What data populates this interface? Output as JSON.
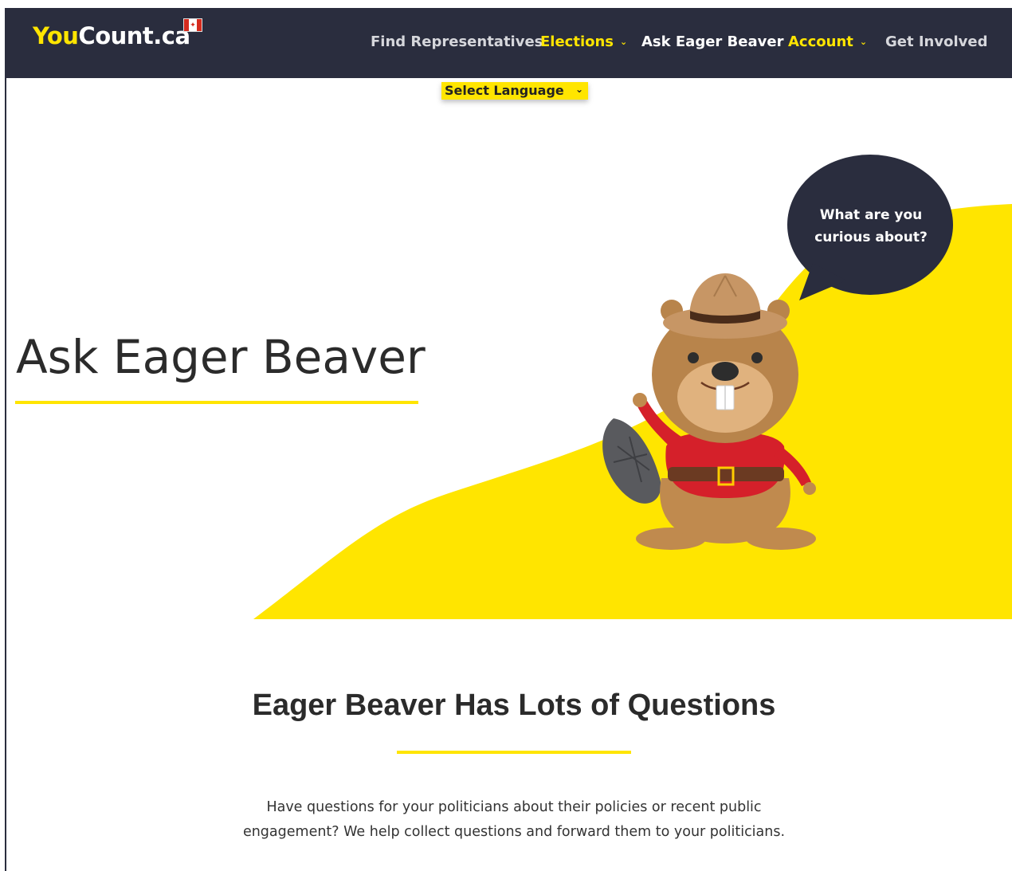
{
  "header": {
    "logo_you": "You",
    "logo_rest": "Count.ca",
    "flag_icon": "canada-flag-icon",
    "nav": [
      {
        "label": "Find Representatives",
        "has_dropdown": false,
        "color": "#d6d7dc"
      },
      {
        "label": "Elections",
        "has_dropdown": true,
        "color": "#ffe500"
      },
      {
        "label": "Ask Eager Beaver",
        "has_dropdown": false,
        "color": "#ffffff"
      },
      {
        "label": "Account",
        "has_dropdown": true,
        "color": "#ffe500"
      },
      {
        "label": "Get Involved",
        "has_dropdown": false,
        "color": "#d6d7dc"
      }
    ],
    "chevron": "⌄"
  },
  "language_select": {
    "selected": "Select Language"
  },
  "hero": {
    "title": "Ask Eager Beaver",
    "bubble_line1": "What are you",
    "bubble_line2": "curious about?",
    "mascot": "beaver-mounted-police-mascot"
  },
  "section": {
    "title": "Eager Beaver Has Lots of Questions",
    "text": "Have questions for your politicians about their policies or recent public engagement? We help collect questions and forward them to your politicians."
  },
  "colors": {
    "accent": "#ffe500",
    "navbar": "#2a2d3e",
    "text": "#2b2b2b"
  }
}
